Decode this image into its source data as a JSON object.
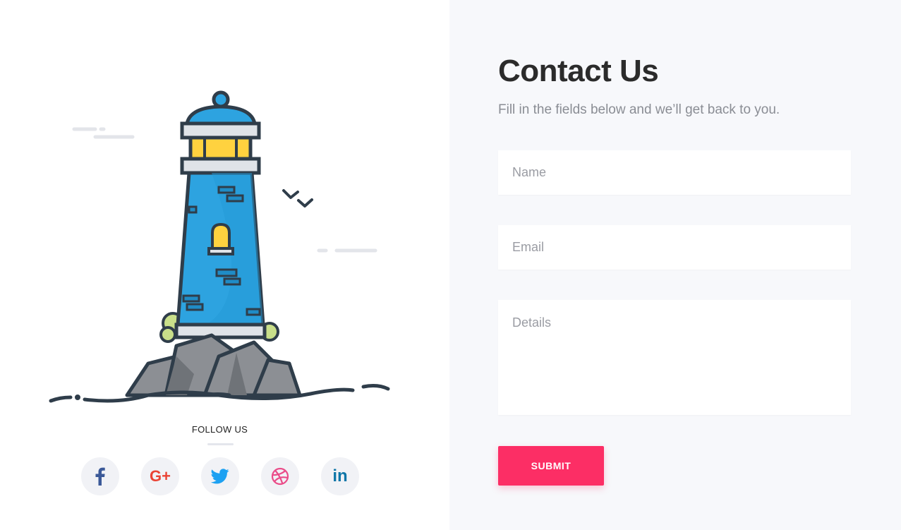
{
  "contact": {
    "title": "Contact Us",
    "subtitle": "Fill in the fields below and we’ll get back to you.",
    "fields": {
      "name_placeholder": "Name",
      "email_placeholder": "Email",
      "details_placeholder": "Details"
    },
    "submit_label": "SUBMIT",
    "accent_color": "#fc2e65"
  },
  "follow": {
    "title": "FOLLOW US",
    "networks": [
      {
        "icon": "facebook-icon",
        "color": "#3b5998"
      },
      {
        "icon": "google-plus-icon",
        "label": "G+",
        "color": "#ea4335"
      },
      {
        "icon": "twitter-icon",
        "color": "#1da1f2"
      },
      {
        "icon": "dribbble-icon",
        "color": "#ea4c89"
      },
      {
        "icon": "linkedin-icon",
        "label": "in",
        "color": "#0e76a8"
      }
    ]
  }
}
